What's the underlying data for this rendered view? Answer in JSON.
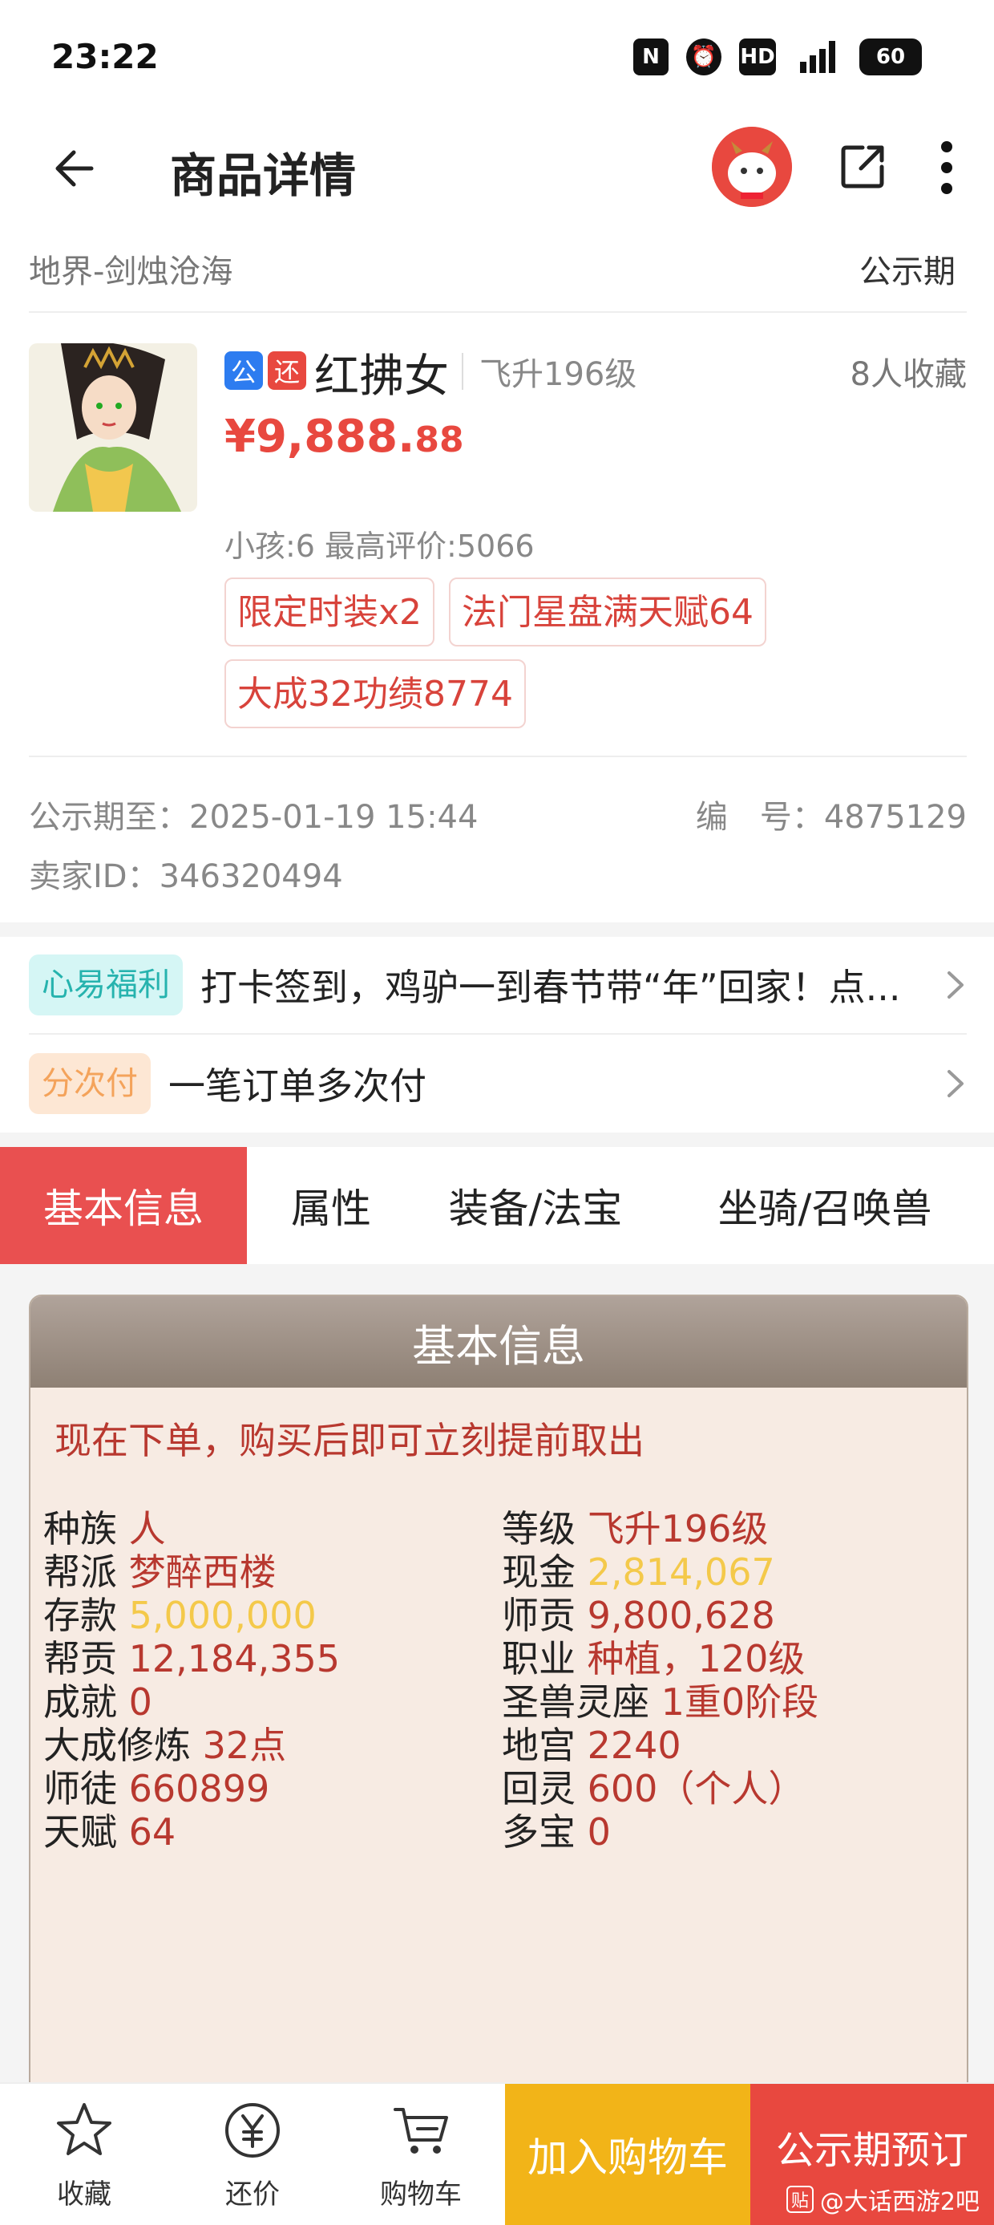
{
  "status_bar": {
    "time": "23:22",
    "battery": "60",
    "network": "4G",
    "hd": "HD"
  },
  "nav": {
    "title": "商品详情"
  },
  "server": {
    "name": "地界-剑烛沧海",
    "status": "公示期"
  },
  "product": {
    "badge_pub": "公",
    "badge_bargain": "还",
    "name": "红拂女",
    "level": "飞升196级",
    "favorites": "8人收藏",
    "price_main": "¥9,888.",
    "price_decimal": "88",
    "kids_rating": "小孩:6 最高评价:5066",
    "tags": [
      "限定时装x2",
      "法门星盘满天赋64",
      "大成32功绩8774"
    ]
  },
  "meta": {
    "deadline": "公示期至：2025-01-19 15:44",
    "number": "编　号：4875129",
    "seller": "卖家ID：346320494"
  },
  "promos": [
    {
      "label": "心易福利",
      "text": "打卡签到，鸡驴一到春节带“年”回家！点..."
    },
    {
      "label": "分次付",
      "text": "一笔订单多次付"
    }
  ],
  "tabs": [
    "基本信息",
    "属性",
    "装备/法宝",
    "坐骑/召唤兽"
  ],
  "card": {
    "title": "基本信息",
    "notice": "现在下单，购买后即可立刻提前取出",
    "left": [
      {
        "k": "种族",
        "v": "人"
      },
      {
        "k": "帮派",
        "v": " 梦醉西楼"
      },
      {
        "k": "存款",
        "v": "5,000,000"
      },
      {
        "k": "帮贡",
        "v": "12,184,355"
      },
      {
        "k": "成就",
        "v": "0"
      },
      {
        "k": "大成修炼",
        "v": "32点"
      },
      {
        "k": "师徒",
        "v": "660899"
      },
      {
        "k": "天赋",
        "v": "64"
      }
    ],
    "right": [
      {
        "k": "等级",
        "v": "飞升196级"
      },
      {
        "k": "现金",
        "v": "2,814,067"
      },
      {
        "k": "师贡",
        "v": "9,800,628"
      },
      {
        "k": "职业",
        "v": "种植，120级"
      },
      {
        "k": "圣兽灵座",
        "v": "1重0阶段"
      },
      {
        "k": "地宫",
        "v": "2240"
      },
      {
        "k": "回灵",
        "v": "600（个人）"
      },
      {
        "k": "多宝",
        "v": "0"
      }
    ]
  },
  "bottom": {
    "favorite": "收藏",
    "bargain": "还价",
    "cart": "购物车",
    "add_to_cart": "加入购物车",
    "reserve": "公示期预订",
    "watermark_icon": "贴",
    "watermark": "@大话西游2吧"
  },
  "colors": {
    "accent_red": "#e8483f",
    "gold": "#f2b418",
    "value_red": "#b8382f",
    "value_gold": "#f4c94a"
  }
}
